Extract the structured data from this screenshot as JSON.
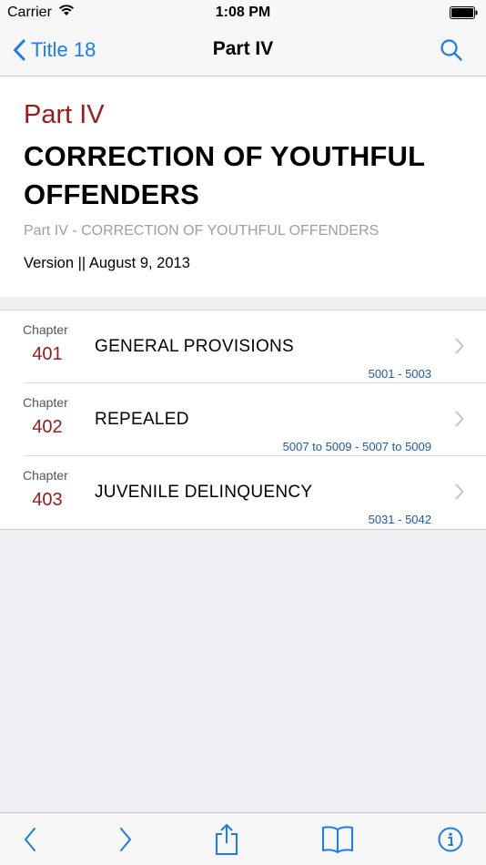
{
  "status_bar": {
    "carrier": "Carrier",
    "time": "1:08 PM"
  },
  "nav": {
    "back_label": "Title 18",
    "title": "Part IV"
  },
  "header": {
    "part_label": "Part IV",
    "heading": "CORRECTION OF YOUTHFUL OFFENDERS",
    "subtitle": "Part IV - CORRECTION OF YOUTHFUL OFFENDERS",
    "version": "Version || August 9, 2013"
  },
  "chapters": [
    {
      "label": "Chapter",
      "number": "401",
      "title": "GENERAL PROVISIONS",
      "range": "5001 - 5003"
    },
    {
      "label": "Chapter",
      "number": "402",
      "title": "REPEALED",
      "range": "5007 to 5009 - 5007 to 5009"
    },
    {
      "label": "Chapter",
      "number": "403",
      "title": "JUVENILE DELINQUENCY",
      "range": "5031 - 5042"
    }
  ],
  "toolbar": {
    "icons": [
      "back-arrow-icon",
      "forward-arrow-icon",
      "share-icon",
      "bookmarks-icon",
      "info-icon"
    ]
  },
  "colors": {
    "accent": "#1a7cf0",
    "part_red": "#9b1b1b",
    "range_blue": "#1d5a9e",
    "background": "#efeff4"
  }
}
